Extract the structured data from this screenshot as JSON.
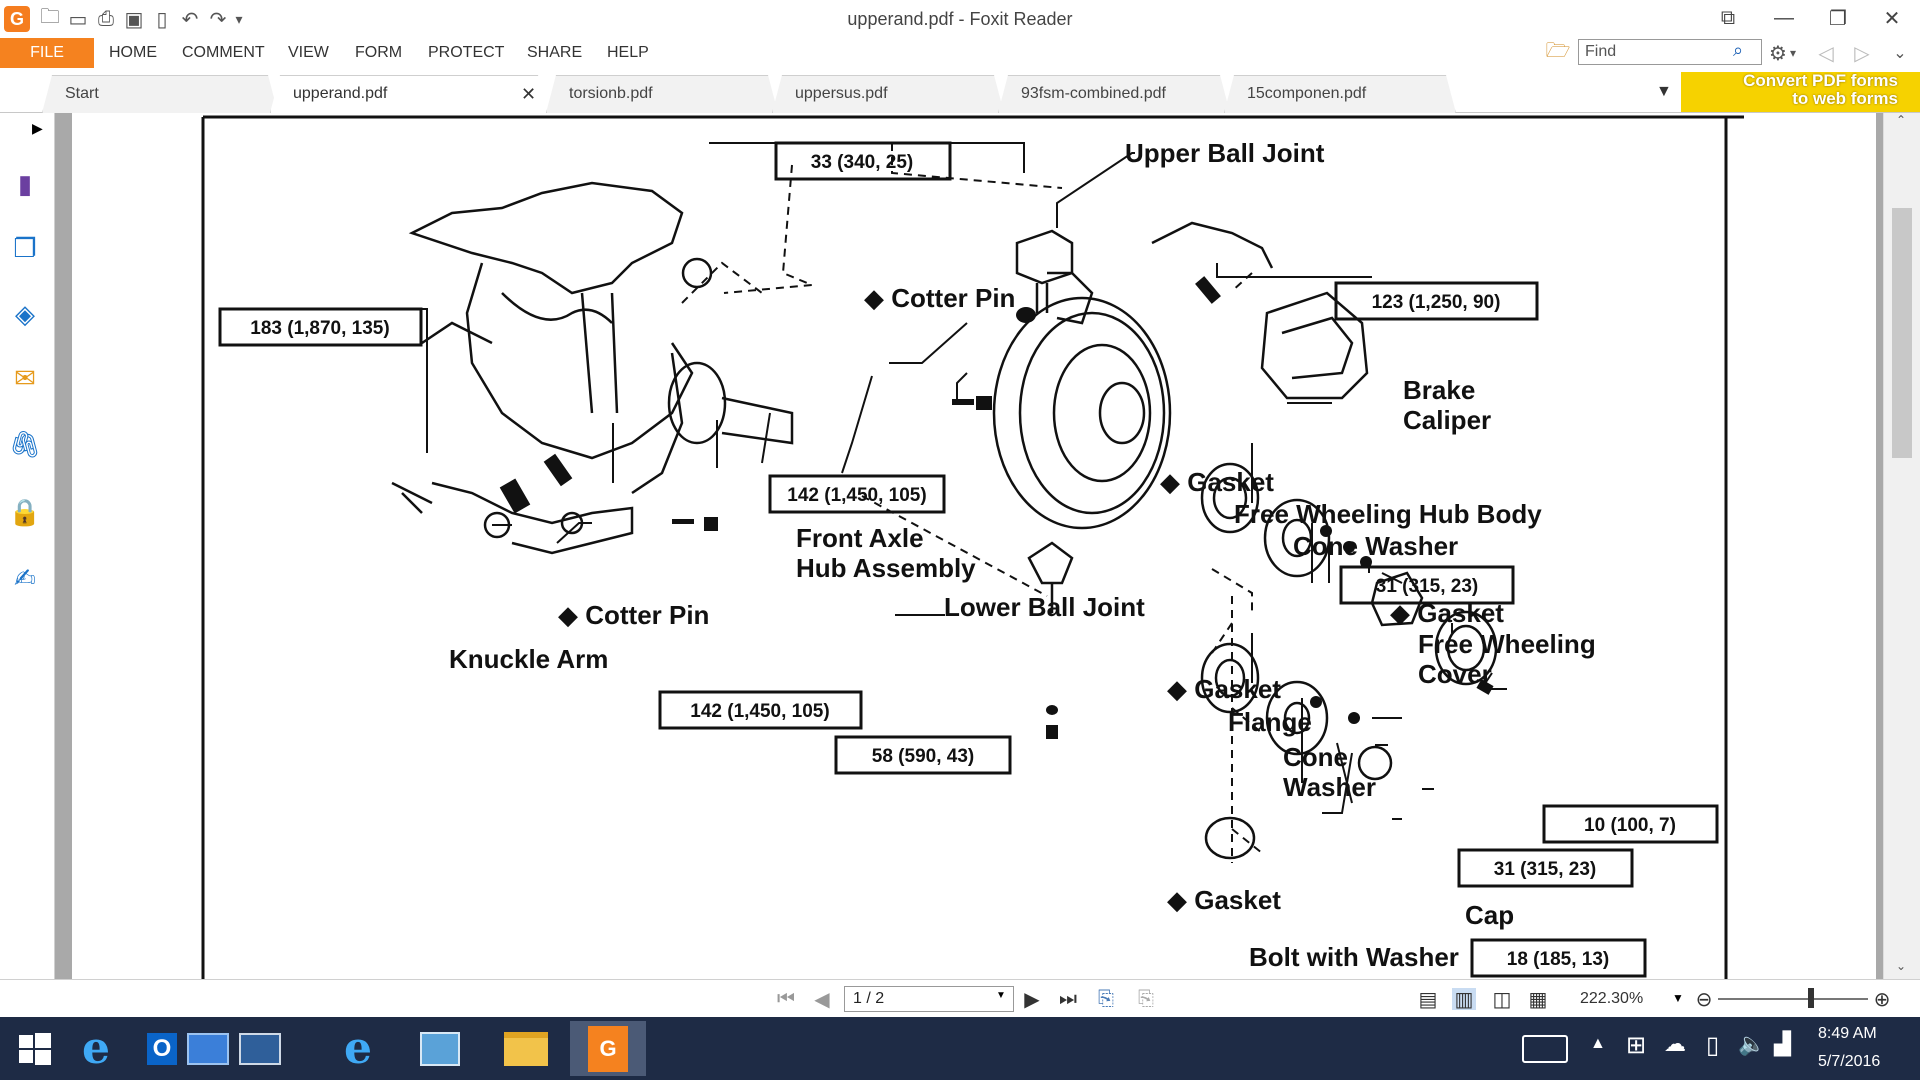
{
  "window": {
    "title": "upperand.pdf - Foxit Reader",
    "app_logo": "G"
  },
  "menu": {
    "file": "FILE",
    "items": [
      "HOME",
      "COMMENT",
      "VIEW",
      "FORM",
      "PROTECT",
      "SHARE",
      "HELP"
    ]
  },
  "search": {
    "placeholder": "Find"
  },
  "tabs": [
    {
      "label": "Start",
      "active": false
    },
    {
      "label": "upperand.pdf",
      "active": true
    },
    {
      "label": "torsionb.pdf",
      "active": false
    },
    {
      "label": "uppersus.pdf",
      "active": false
    },
    {
      "label": "93fsm-combined.pdf",
      "active": false
    },
    {
      "label": "15componen.pdf",
      "active": false
    }
  ],
  "promo": {
    "line1": "Convert PDF forms",
    "line2": "to web forms"
  },
  "diagram": {
    "labels": {
      "upper_ball_joint": "Upper Ball Joint",
      "cotter_pin_top": "◆ Cotter Pin",
      "brake": "Brake",
      "caliper": "Caliper",
      "gasket1": "◆ Gasket",
      "free_wheeling_hub_body": "Free Wheeling Hub Body",
      "cone_washer1": "Cone Washer",
      "gasket2": "◆ Gasket",
      "free_wheeling": "Free Wheeling",
      "cover": "Cover",
      "front_axle": "Front Axle",
      "hub_assembly": "Hub Assembly",
      "lower_ball_joint": "Lower Ball Joint",
      "cotter_pin_bottom": "◆ Cotter Pin",
      "knuckle_arm": "Knuckle Arm",
      "gasket3": "◆ Gasket",
      "flange": "Flange",
      "cone": "Cone",
      "washer": "Washer",
      "gasket4": "◆ Gasket",
      "cap": "Cap",
      "bolt_with_washer": "Bolt with Washer"
    },
    "torque_boxes": {
      "t33": "33 (340, 25)",
      "t123": "123 (1,250, 90)",
      "t183": "183 (1,870, 135)",
      "t142a": "142 (1,450, 105)",
      "t31a": "31 (315, 23)",
      "t142b": "142 (1,450, 105)",
      "t58": "58 (590, 43)",
      "t10": "10 (100, 7)",
      "t31b": "31 (315, 23)",
      "t18": "18 (185, 13)"
    }
  },
  "status": {
    "page": "1 / 2",
    "zoom": "222.30%"
  },
  "clock": {
    "time": "8:49 AM",
    "date": "5/7/2016"
  },
  "colors": {
    "accent": "#f5821f",
    "taskbar": "#1e2b45",
    "promo": "#f6d200"
  }
}
